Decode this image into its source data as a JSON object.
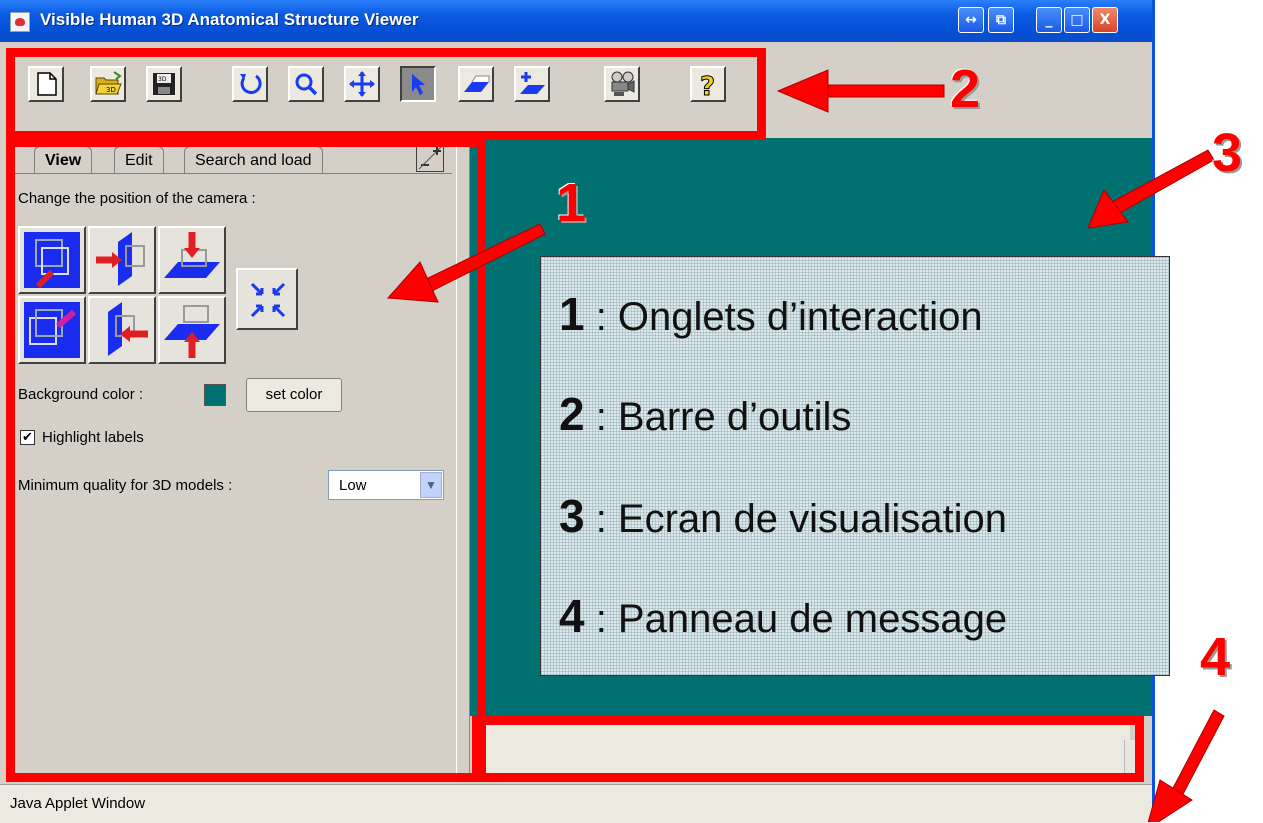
{
  "window": {
    "title": "Visible Human 3D Anatomical Structure Viewer",
    "title_buttons": [
      "↔",
      "⧉",
      "_",
      "□",
      "X"
    ]
  },
  "toolbar": {
    "buttons": [
      "new-document",
      "open-3d",
      "save",
      "rotate",
      "zoom",
      "pan",
      "select-pointer",
      "slice-plane",
      "add-slice-plane",
      "movie-camera",
      "help"
    ],
    "active": "select-pointer"
  },
  "tabs": {
    "items": [
      "View",
      "Edit",
      "Search and load"
    ],
    "active": "View"
  },
  "view_panel": {
    "camera_label": "Change the position of the camera :",
    "background_label": "Background color :",
    "background_color": "#007070",
    "set_color_label": "set color",
    "highlight_label": "Highlight labels",
    "highlight_checked": "✔",
    "quality_label": "Minimum quality for 3D models :",
    "quality_value": "Low"
  },
  "status_bar": {
    "text": "Java Applet Window"
  },
  "legend": {
    "items": [
      {
        "num": "1",
        "text": " : Onglets d’interaction"
      },
      {
        "num": "2",
        "text": " : Barre d’outils"
      },
      {
        "num": "3",
        "text": " : Ecran de visualisation"
      },
      {
        "num": "4",
        "text": " : Panneau de message"
      }
    ]
  },
  "callouts": [
    "1",
    "2",
    "3",
    "4"
  ],
  "colors": {
    "highlight": "#ff0000",
    "viewport": "#007070",
    "titlebar": "#0550d8"
  }
}
